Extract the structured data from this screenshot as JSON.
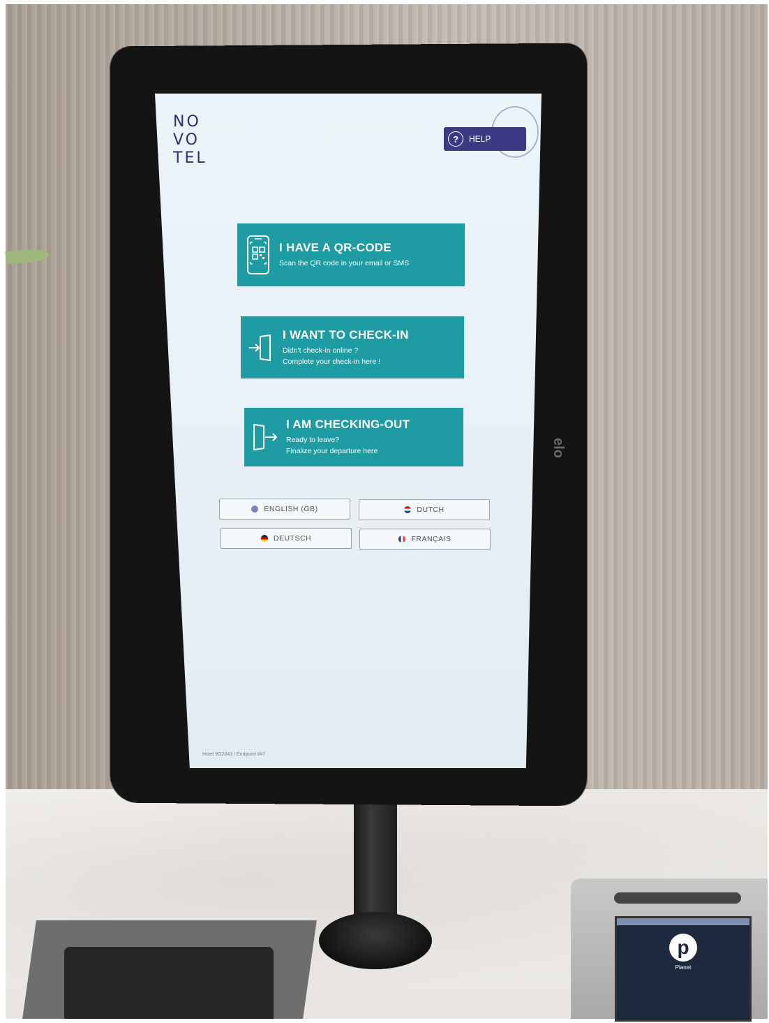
{
  "kiosk": {
    "brand": {
      "line1": "NO",
      "line2": "VO",
      "line3": "TEL"
    },
    "help": {
      "label": "HELP",
      "icon": "question-circle-icon"
    },
    "actions": [
      {
        "icon": "qr-phone-icon",
        "title": "I HAVE A QR-CODE",
        "sub1": "Scan the QR code in your email or SMS",
        "sub2": ""
      },
      {
        "icon": "door-enter-icon",
        "title": "I WANT TO CHECK-IN",
        "sub1": "Didn't check-in online ?",
        "sub2": "Complete your check-in here !"
      },
      {
        "icon": "door-exit-icon",
        "title": "I AM CHECKING-OUT",
        "sub1": "Ready to leave?",
        "sub2": "Finalize your departure here"
      }
    ],
    "languages": [
      {
        "label": "ENGLISH (GB)",
        "flag": "uk-flag-icon",
        "color": "#7a84c4"
      },
      {
        "label": "DUTCH",
        "flag": "netherlands-flag-icon",
        "color": "#c8102e"
      },
      {
        "label": "DEUTSCH",
        "flag": "germany-flag-icon",
        "color": "#222222"
      },
      {
        "label": "FRANÇAIS",
        "flag": "france-flag-icon",
        "color": "#1f3a93"
      }
    ],
    "footer": "Hotel 9G2043 / Endpoint 847",
    "accent_color": "#1f9ca3",
    "help_color": "#3c3a82"
  },
  "device": {
    "brand": "elo"
  },
  "terminal": {
    "brand": "Planet"
  }
}
